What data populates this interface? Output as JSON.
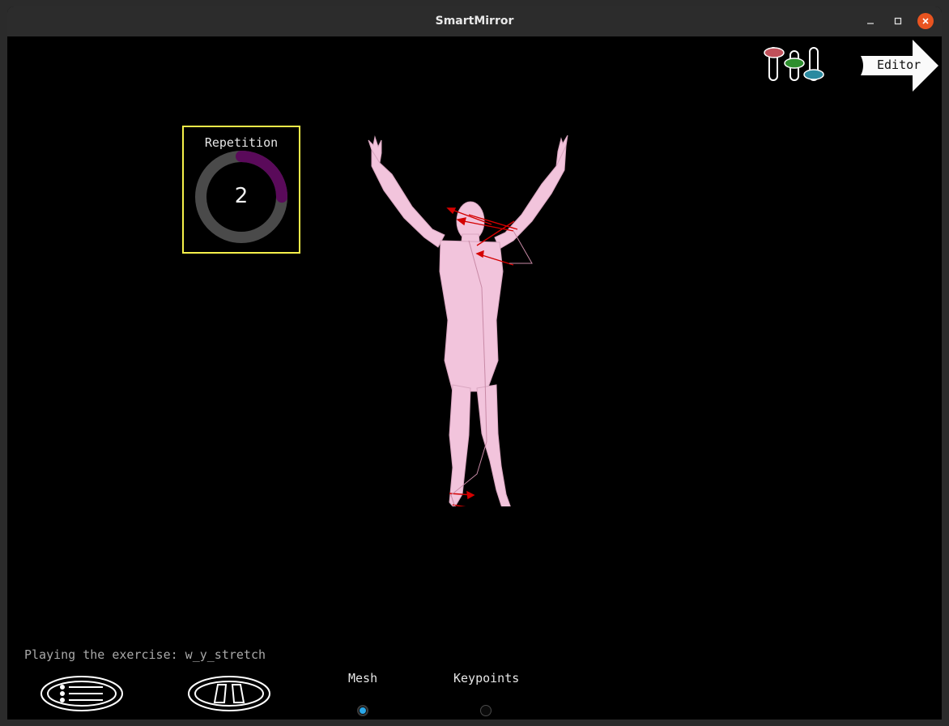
{
  "window": {
    "title": "SmartMirror"
  },
  "toolbar": {
    "settings_icon": "sliders-icon",
    "editor_label": "Editor"
  },
  "repetition": {
    "title": "Repetition",
    "count": "2",
    "progress": 0.25,
    "ring_color": "#4a4a4a",
    "progress_color": "#5a0a5a",
    "border_color": "#f5f04a"
  },
  "viewer": {
    "body_color": "#f2c4dc",
    "arrow_color": "#d40000"
  },
  "status": {
    "text": "Playing the exercise: w_y_stretch"
  },
  "bottom_bar": {
    "list_button_icon": "list-icon",
    "feet_button_icon": "feet-icon"
  },
  "view_mode": {
    "options": [
      {
        "label": "Mesh",
        "selected": true
      },
      {
        "label": "Keypoints",
        "selected": false
      }
    ],
    "accent": "#2aa7e8"
  }
}
